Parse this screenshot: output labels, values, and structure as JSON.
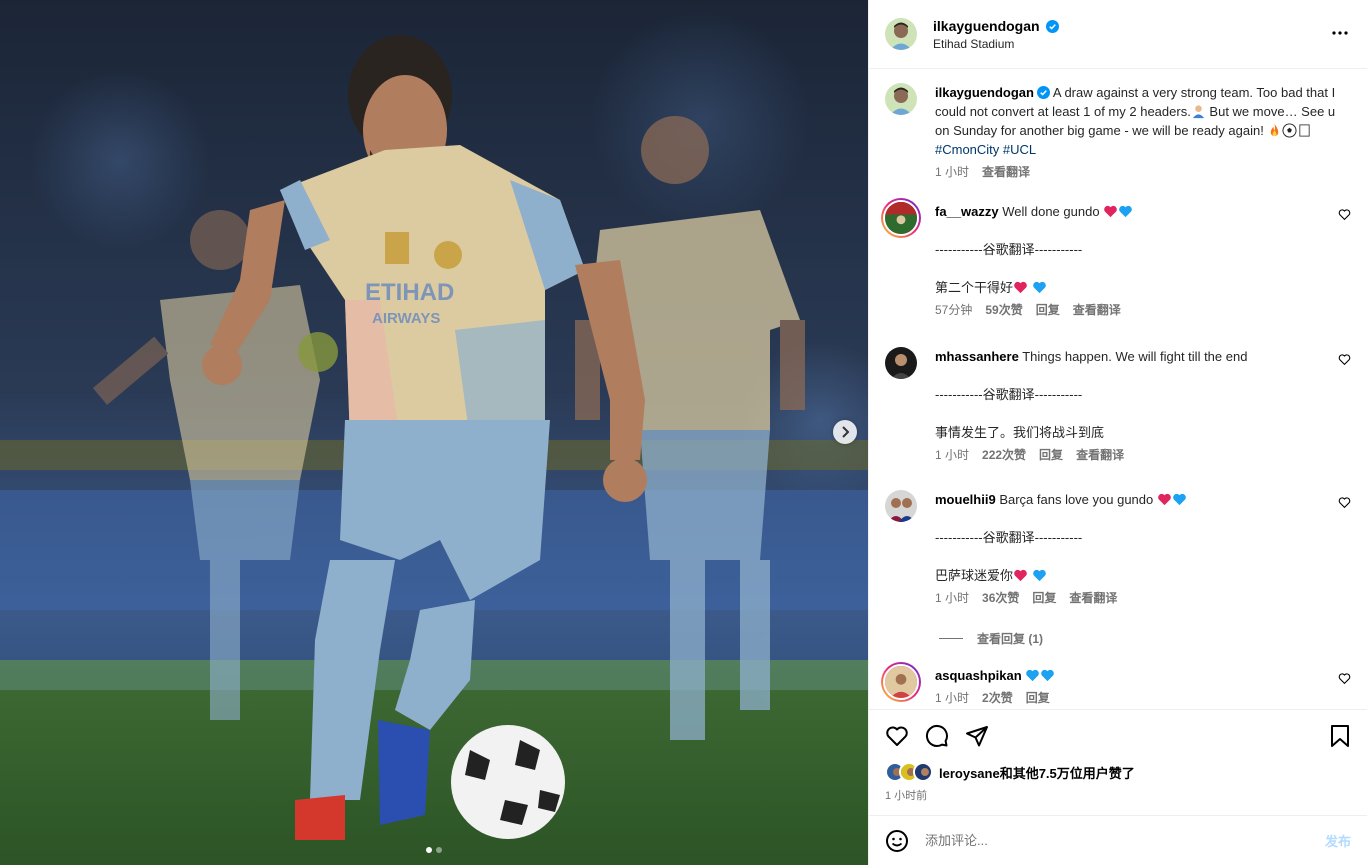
{
  "post": {
    "author": "ilkayguendogan",
    "location": "Etihad Stadium",
    "caption": "A draw against a very strong team. Too bad that I could not convert at least 1 of my 2 headers.",
    "caption_tail": " But we move… See u on Sunday for another big game - we will be ready again!",
    "hashtags": [
      "#CmonCity",
      "#UCL"
    ],
    "caption_time": "1 小时",
    "see_translation": "查看翻译",
    "carousel": {
      "slide_count": 2,
      "active_index": 0
    }
  },
  "comments": [
    {
      "user": "fa__wazzy",
      "text": "Well done gundo",
      "separator": "-----------谷歌翻译-----------",
      "translation": "第二个干得好",
      "time": "57分钟",
      "likes": "59次赞",
      "reply": "回复",
      "see_translation": "查看翻译"
    },
    {
      "user": "mhassanhere",
      "text": "Things happen. We will fight till the end",
      "separator": "-----------谷歌翻译-----------",
      "translation": "事情发生了。我们将战斗到底",
      "time": "1 小时",
      "likes": "222次赞",
      "reply": "回复",
      "see_translation": "查看翻译"
    },
    {
      "user": "mouelhii9",
      "text": "Barça fans love you gundo",
      "separator": "-----------谷歌翻译-----------",
      "translation": "巴萨球迷爱你",
      "time": "1 小时",
      "likes": "36次赞",
      "reply": "回复",
      "see_translation": "查看翻译",
      "view_replies": "查看回复 (1)"
    },
    {
      "user": "asquashpikan",
      "text": "",
      "time": "1 小时",
      "likes": "2次赞",
      "reply": "回复"
    }
  ],
  "likes_summary": "leroysane和其他7.5万位用户赞了",
  "posted_time": "1 小时前",
  "composer": {
    "placeholder": "添加评论...",
    "post_label": "发布"
  },
  "colors": {
    "verified": "#0095f6",
    "link": "#00376b",
    "meta": "#737373",
    "red_heart": "#e0245e",
    "blue_heart": "#1da1f2"
  }
}
